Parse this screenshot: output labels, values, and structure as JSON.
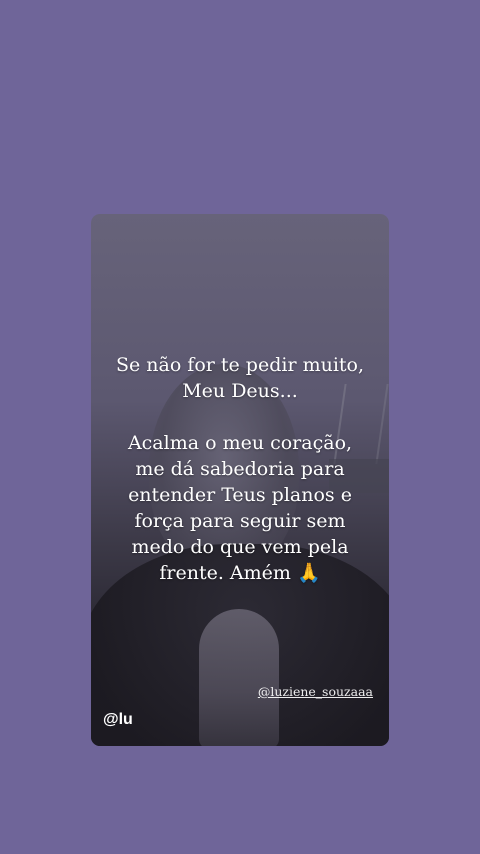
{
  "background_color": "#6f6599",
  "story": {
    "quote_lines": [
      "Se não for te pedir muito,",
      "Meu Deus...",
      "",
      "Acalma o meu coração,",
      "me dá sabedoria para",
      "entender Teus planos e",
      "força para seguir sem",
      "medo do que vem pela",
      "frente. Amém"
    ],
    "emoji": "🙏",
    "author_handle": "@luziene_souzaaa",
    "watermark": "@lu"
  }
}
